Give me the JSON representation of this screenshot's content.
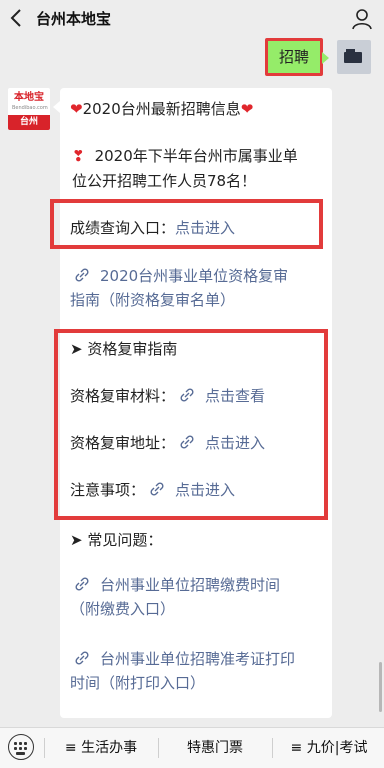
{
  "header": {
    "back_icon": "chevron-left-icon",
    "title": "台州本地宝",
    "profile_icon": "user-icon"
  },
  "outgoing": {
    "text": "招聘"
  },
  "sender": {
    "brand": "本地宝",
    "brand_sub": "Bendibao.com",
    "city": "台州"
  },
  "message": {
    "heading": "2020台州最新招聘信息",
    "notice_line1": "2020年下半年台州市属事业单",
    "notice_line2": "位公开招聘工作人员78名！",
    "score_label": "成绩查询入口：",
    "score_link": "点击进入",
    "review_link_line1": "2020台州事业单位资格复审",
    "review_link_line2": "指南（附资格复审名单）",
    "guide_heading": "➤ 资格复审指南",
    "materials_label": "资格复审材料：",
    "materials_link": "点击查看",
    "address_label": "资格复审地址：",
    "address_link": "点击进入",
    "notes_label": "注意事项：",
    "notes_link": "点击进入",
    "faq_heading": "➤ 常见问题：",
    "faq1_line1": "台州事业单位招聘缴费时间",
    "faq1_line2": "（附缴费入口）",
    "faq2_line1": "台州事业单位招聘准考证打印",
    "faq2_line2": "时间（附打印入口）"
  },
  "bottom_menu": {
    "keyboard_icon": "keyboard-icon",
    "item1": "≡ 生活办事",
    "item2": "特惠门票",
    "item3": "≡ 九价|考试"
  },
  "colors": {
    "link": "#576b95",
    "highlight_border": "#e23b3b",
    "outgoing_bubble": "#95ec69"
  }
}
